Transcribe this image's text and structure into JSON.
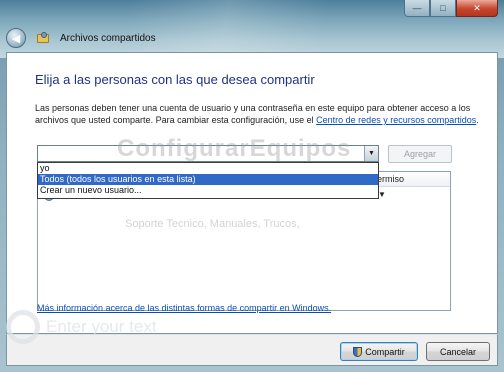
{
  "window": {
    "title": "Archivos compartidos",
    "minimize_glyph": "—",
    "maximize_glyph": "□",
    "close_glyph": "✕",
    "back_glyph": "◀"
  },
  "main": {
    "heading": "Elija a las personas con las que desea compartir",
    "description_text": "Las personas deben tener una cuenta de usuario y una contraseña en este equipo para obtener acceso a los archivos que usted comparte. Para cambiar esta configuración, use el ",
    "description_link": "Centro de redes y recursos compartidos",
    "description_end": ".",
    "combo_value": "",
    "combo_arrow": "▼",
    "add_button": "Agregar",
    "dropdown_options": [
      "yo",
      "Todos (todos los usuarios en esta lista)",
      "Crear un nuevo usuario..."
    ],
    "selected_option_index": 1,
    "column_permission": "Nivel de permiso",
    "column_permission_visible": "ermiso",
    "row_caret": "▼",
    "more_info_link": "Más información acerca de las distintas formas de compartir en Windows."
  },
  "watermarks": {
    "title": "ConfigurarEquipos",
    "subtitle": "Soporte Tecnico, Manuales, Trucos,",
    "bottom": "Enter your text"
  },
  "footer": {
    "share_button": "Compartir",
    "cancel_button": "Cancelar"
  },
  "colors": {
    "heading": "#1e3287",
    "link": "#0a4cb8",
    "selection": "#3169c6"
  },
  "icons": {
    "back": "back-arrow-icon",
    "window": "shared-folder-icon",
    "user": "user-icon",
    "shield": "uac-shield-icon"
  }
}
